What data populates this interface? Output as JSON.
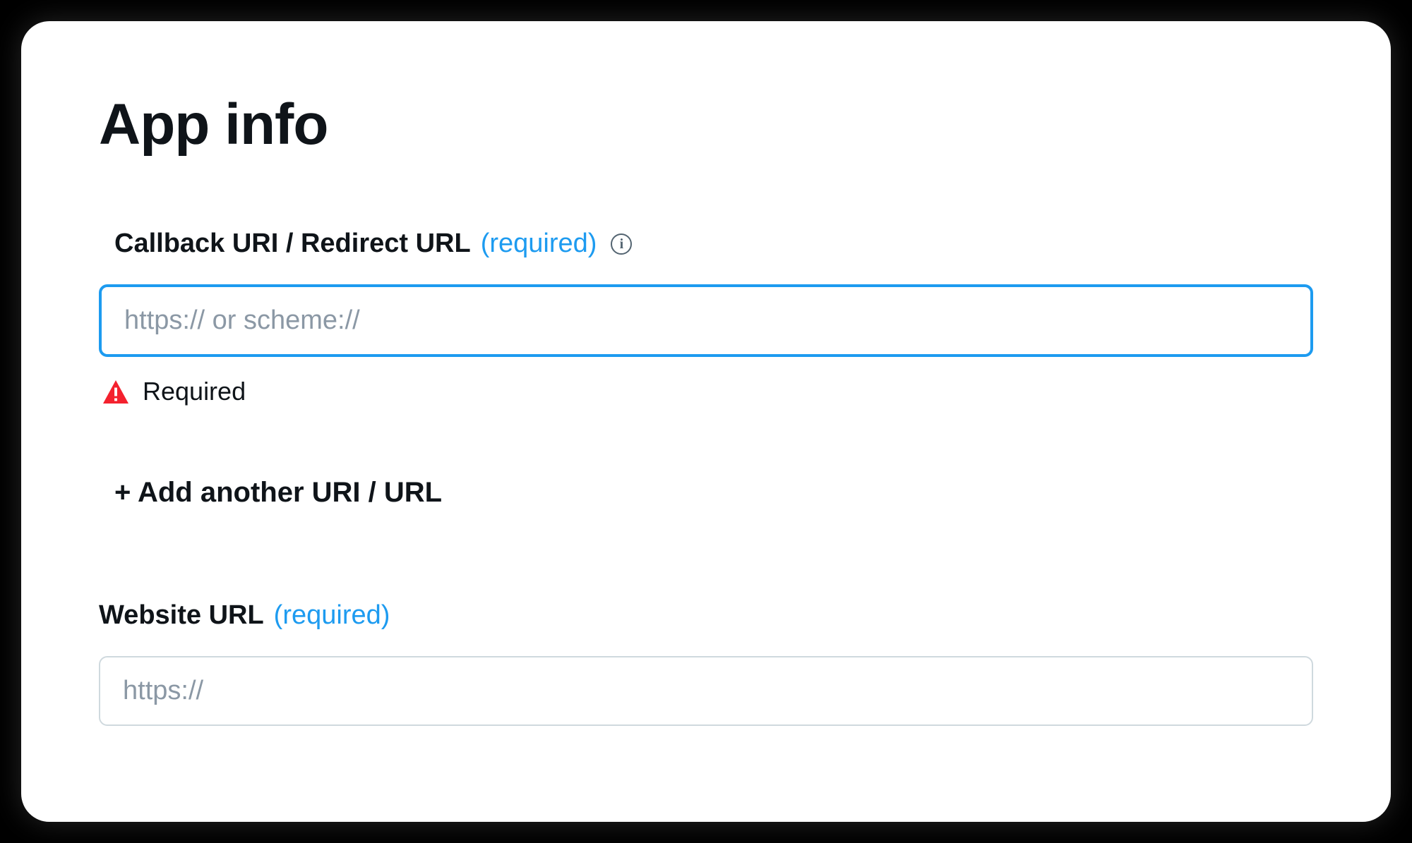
{
  "header": {
    "title": "App info"
  },
  "callback": {
    "label": "Callback URI / Redirect URL",
    "required_tag": "(required)",
    "placeholder": "https:// or scheme://",
    "value": "",
    "error_text": "Required",
    "add_link": "+ Add another URI / URL"
  },
  "website": {
    "label": "Website URL",
    "required_tag": "(required)",
    "placeholder": "https://",
    "value": ""
  },
  "colors": {
    "accent": "#1d9bf0",
    "error": "#f4212e",
    "text": "#0f1419",
    "placeholder": "#8b98a5",
    "border": "#cfd9de"
  }
}
